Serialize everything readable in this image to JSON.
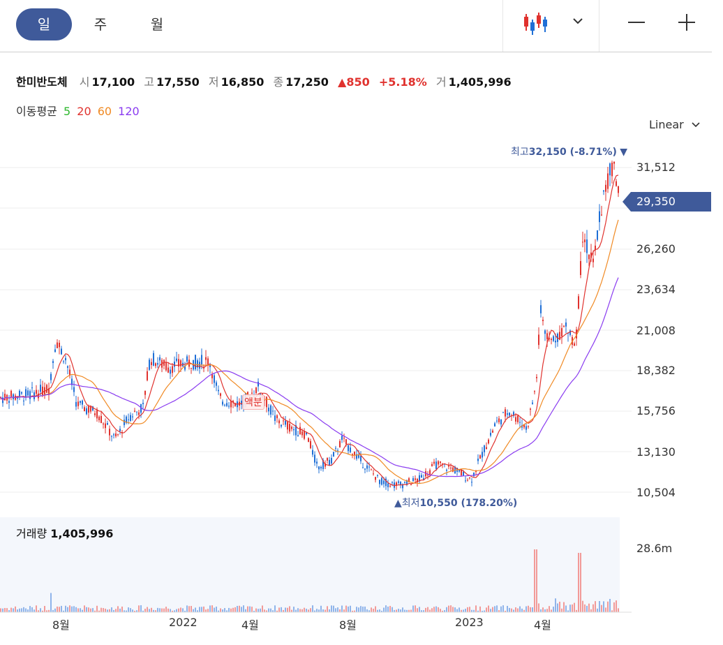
{
  "toolbar": {
    "periods": [
      "일",
      "주",
      "월"
    ],
    "active_period": "일",
    "chart_type_icon": "candlestick-icon",
    "dropdown_icon": "chevron-down-icon",
    "zoom_out_icon": "minus-icon",
    "zoom_in_icon": "plus-icon"
  },
  "stock": {
    "name": "한미반도체",
    "open_label": "시",
    "open": "17,100",
    "high_label": "고",
    "high": "17,550",
    "low_label": "저",
    "low": "16,850",
    "close_label": "종",
    "close": "17,250",
    "change": "850",
    "change_pct": "+5.18%",
    "volume_label": "거",
    "volume": "1,405,996"
  },
  "moving_average": {
    "label": "이동평균",
    "periods": [
      {
        "value": "5",
        "color": "#2eb82e"
      },
      {
        "value": "20",
        "color": "#e0322e"
      },
      {
        "value": "60",
        "color": "#f08a24"
      },
      {
        "value": "120",
        "color": "#8a3cf0"
      }
    ]
  },
  "scale": {
    "label": "Linear"
  },
  "price_axis": [
    "31,512",
    "26,260",
    "23,634",
    "21,008",
    "18,382",
    "15,756",
    "13,130",
    "10,504"
  ],
  "current_price": "29,350",
  "high_marker": {
    "label": "최고",
    "value": "32,150 (-8.71%)"
  },
  "low_marker": {
    "label": "최저",
    "value": "10,550 (178.20%)"
  },
  "badge": {
    "text": "액분"
  },
  "volume_panel": {
    "title": "거래량",
    "value": "1,405,996",
    "max_label": "28.6m"
  },
  "time_axis": [
    "8월",
    "2022",
    "4월",
    "8월",
    "2023",
    "4월"
  ],
  "colors": {
    "accent": "#3f5a9a",
    "up": "#e0322e",
    "down": "#1f6fd6",
    "vol_bg": "#f4f7fc"
  }
}
